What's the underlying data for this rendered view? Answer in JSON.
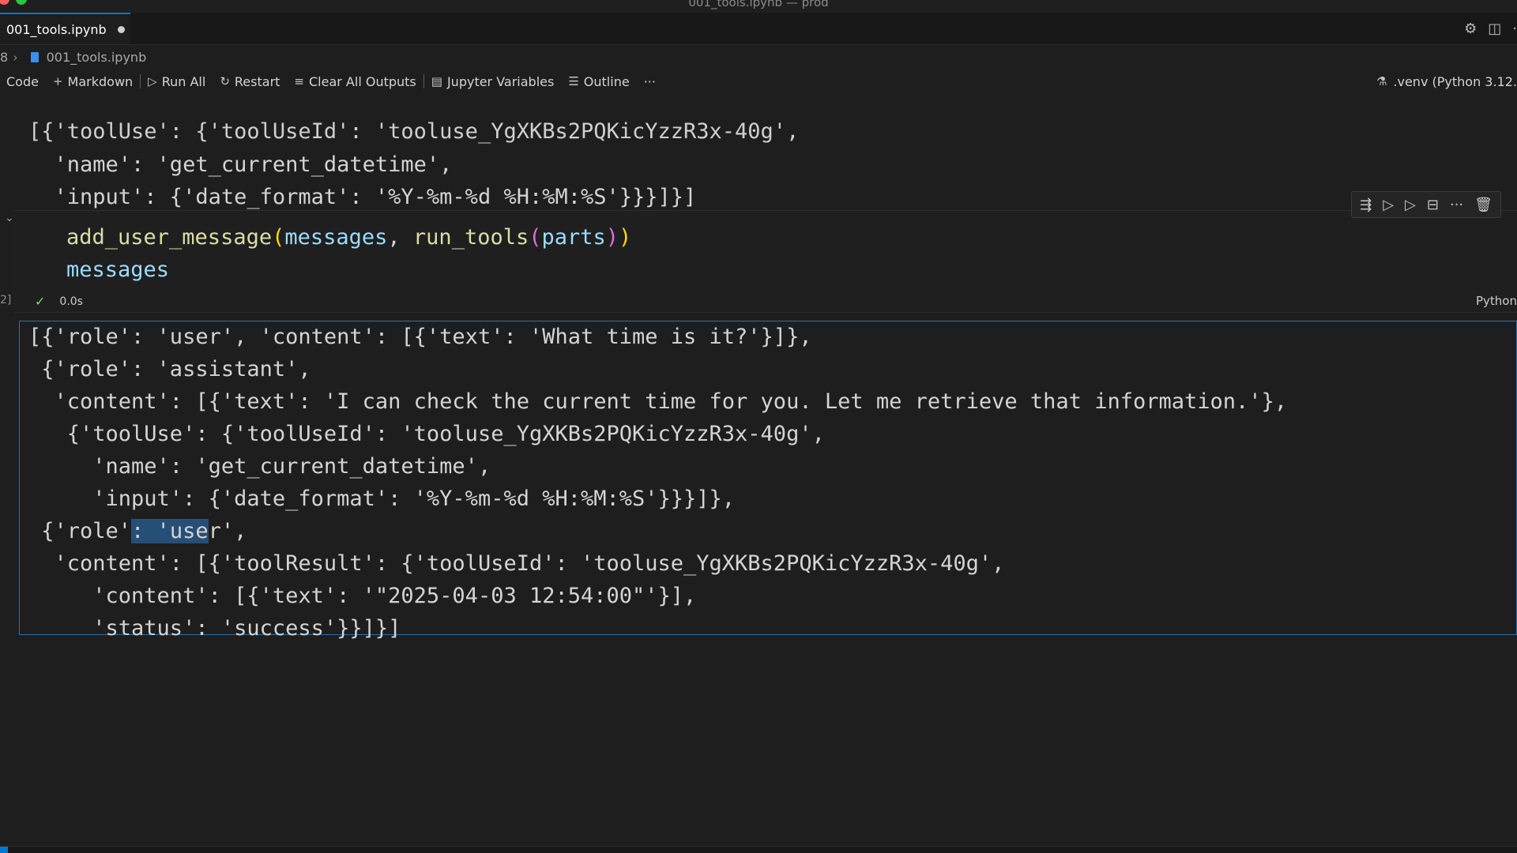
{
  "window": {
    "title": "001_tools.ipynb — prod",
    "colors": {
      "close": "#ff5f57",
      "minimize": "#febc2e",
      "zoom": "#28c840"
    }
  },
  "tab": {
    "label": "001_tools.ipynb",
    "modified": true
  },
  "breadcrumb": {
    "parent": "8",
    "file": "001_tools.ipynb"
  },
  "toolbar": {
    "code_label": "Code",
    "markdown_label": "Markdown",
    "run_all_label": "Run All",
    "restart_label": "Restart",
    "clear_outputs_label": "Clear All Outputs",
    "variables_label": "Jupyter Variables",
    "outline_label": "Outline",
    "more_label": "···",
    "kernel_label": ".venv (Python 3.12."
  },
  "previous_output": {
    "clipped_line": "[{'toolUse': {'toolUseId': 'tooluse_YgXKBs2PQKicYzzR3x-40g',",
    "lines": [
      "  'name': 'get_current_datetime',",
      "  'input': {'date_format': '%Y-%m-%d %H:%M:%S'}}}]}]"
    ]
  },
  "cell": {
    "execution_count": "2]",
    "duration": "0.0s",
    "language": "Python",
    "code": {
      "fn1": "add_user_message",
      "arg1": "messages",
      "fn2": "run_tools",
      "arg2": "parts",
      "line2": "messages"
    }
  },
  "output": {
    "lines": [
      "[{'role': 'user', 'content': [{'text': 'What time is it?'}]},",
      " {'role': 'assistant',",
      "  'content': [{'text': 'I can check the current time for you. Let me retrieve that information.'},",
      "   {'toolUse': {'toolUseId': 'tooluse_YgXKBs2PQKicYzzR3x-40g',",
      "     'name': 'get_current_datetime',",
      "     'input': {'date_format': '%Y-%m-%d %H:%M:%S'}}}]},",
      null,
      "  'content': [{'toolResult': {'toolUseId': 'tooluse_YgXKBs2PQKicYzzR3x-40g',",
      "     'content': [{'text': '\"2025-04-03 12:54:00\"'}],",
      "     'status': 'success'}}]}]"
    ],
    "line7_before": " {'role'",
    "line7_selected": ": 'use",
    "line7_after": "r',"
  }
}
